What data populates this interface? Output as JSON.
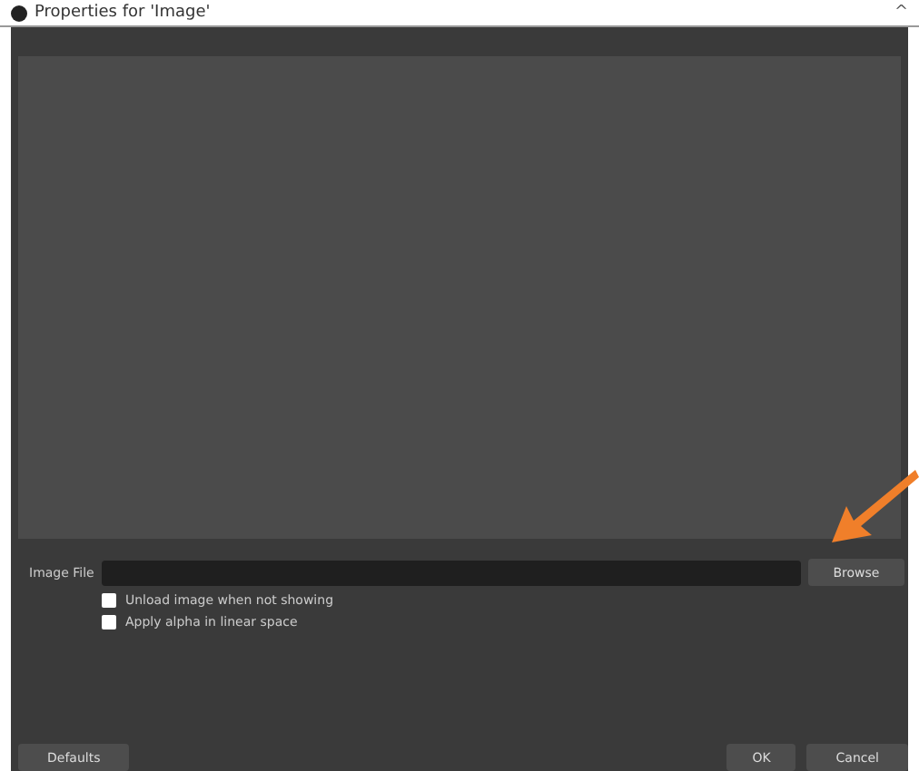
{
  "window": {
    "title": "Properties for 'Image'",
    "collapse_glyph": "^"
  },
  "image_file": {
    "label": "Image File"
  },
  "browse_button": "Browse",
  "options": [
    {
      "label": "Unload image when not showing",
      "checked": false
    },
    {
      "label": "Apply alpha in linear space",
      "checked": false
    }
  ],
  "buttons": {
    "defaults": "Defaults",
    "ok": "OK",
    "cancel": "Cancel"
  }
}
